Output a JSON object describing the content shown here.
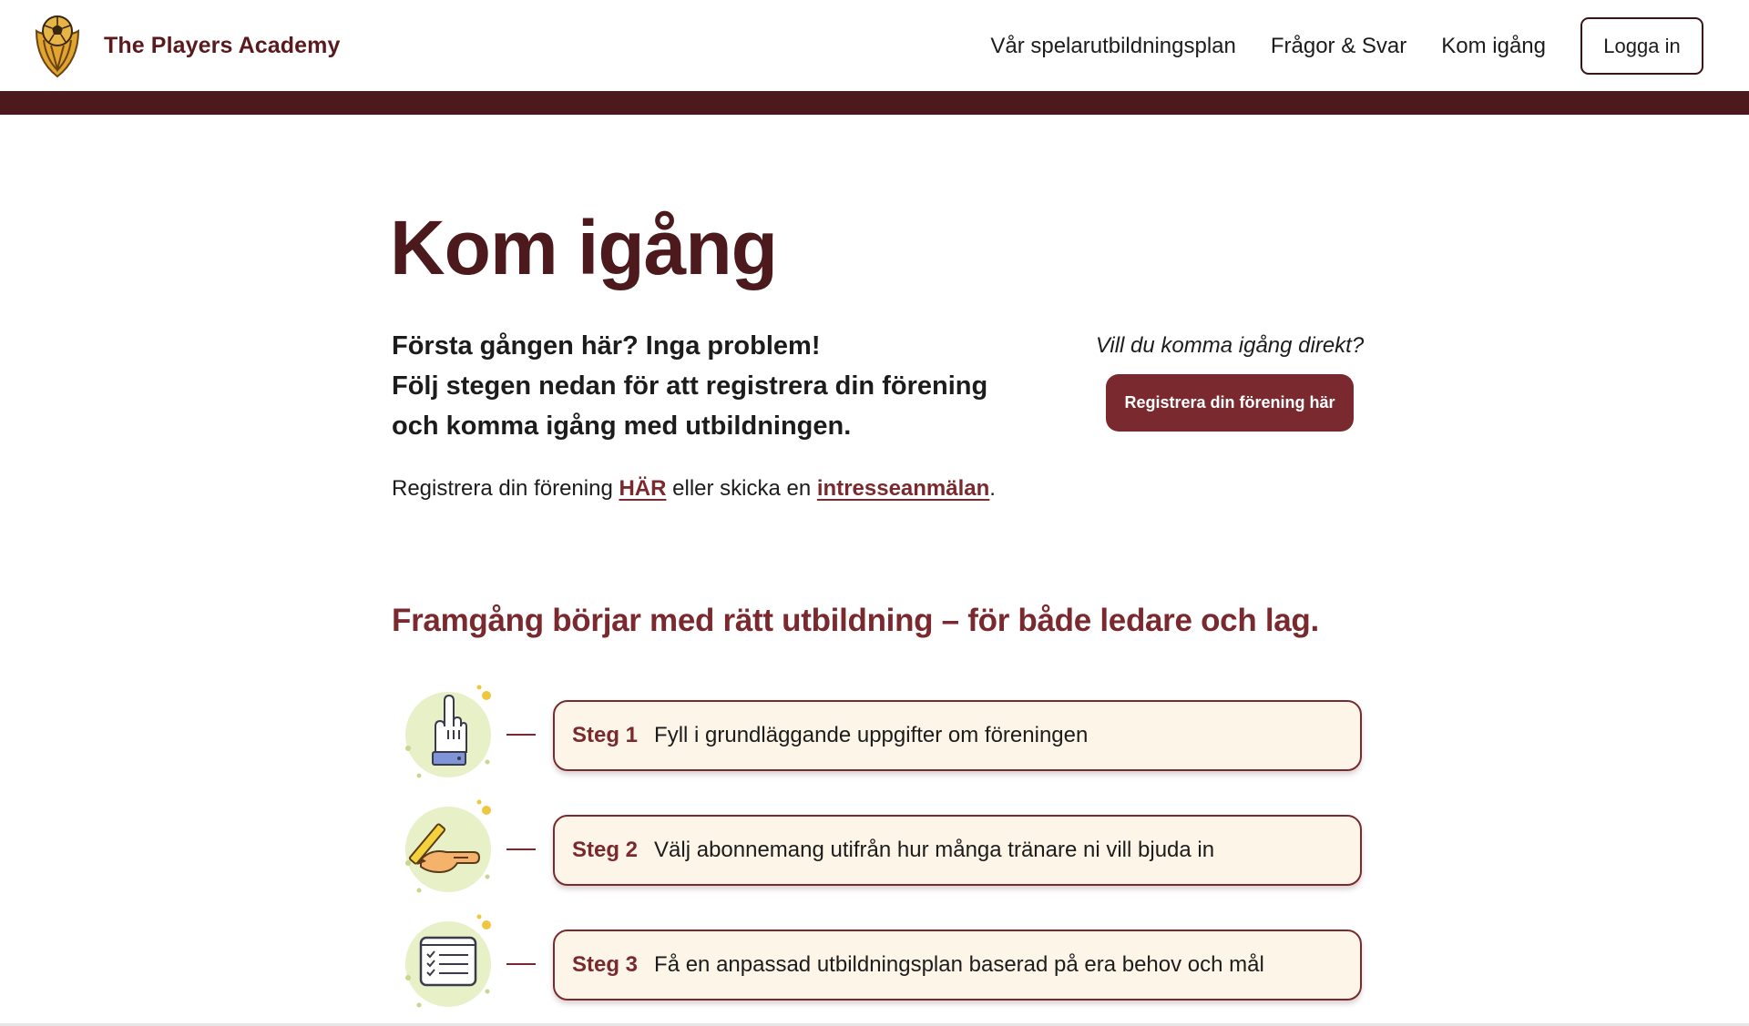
{
  "header": {
    "brand_name": "The Players Academy",
    "logo_icon": "football-shield-logo",
    "nav": [
      {
        "label": "Vår spelarutbildningsplan"
      },
      {
        "label": "Frågor & Svar"
      },
      {
        "label": "Kom igång"
      }
    ],
    "login_label": "Logga in"
  },
  "main": {
    "title": "Kom igång",
    "intro_lines": [
      "Första gången här? Inga problem!",
      "Följ stegen nedan för att registrera din förening",
      "och komma igång med utbildningen."
    ],
    "register_prefix": "Registrera din förening ",
    "register_link": "HÄR",
    "register_middle": " eller skicka en ",
    "interest_link": "intresseanmälan",
    "register_suffix": "."
  },
  "cta": {
    "question": "Vill du komma igång direkt?",
    "button_label": "Registrera din förening här"
  },
  "section": {
    "heading": "Framgång börjar med rätt utbildning – för både ledare och lag."
  },
  "steps": [
    {
      "label": "Steg 1",
      "text": "Fyll i grundläggande uppgifter om föreningen",
      "icon": "pointing-hand-icon"
    },
    {
      "label": "Steg 2",
      "text": "Välj abonnemang utifrån hur många tränare ni vill bjuda in",
      "icon": "hand-writing-icon"
    },
    {
      "label": "Steg 3",
      "text": "Få en anpassad utbildningsplan baserad på era behov och mål",
      "icon": "checklist-icon"
    }
  ],
  "colors": {
    "brand_dark": "#4c1a1c",
    "brand_accent": "#7a2a2e",
    "card_background": "#fdf6e8",
    "illustration_circle": "#e8f0c8",
    "logo_gold": "#e0a430"
  }
}
